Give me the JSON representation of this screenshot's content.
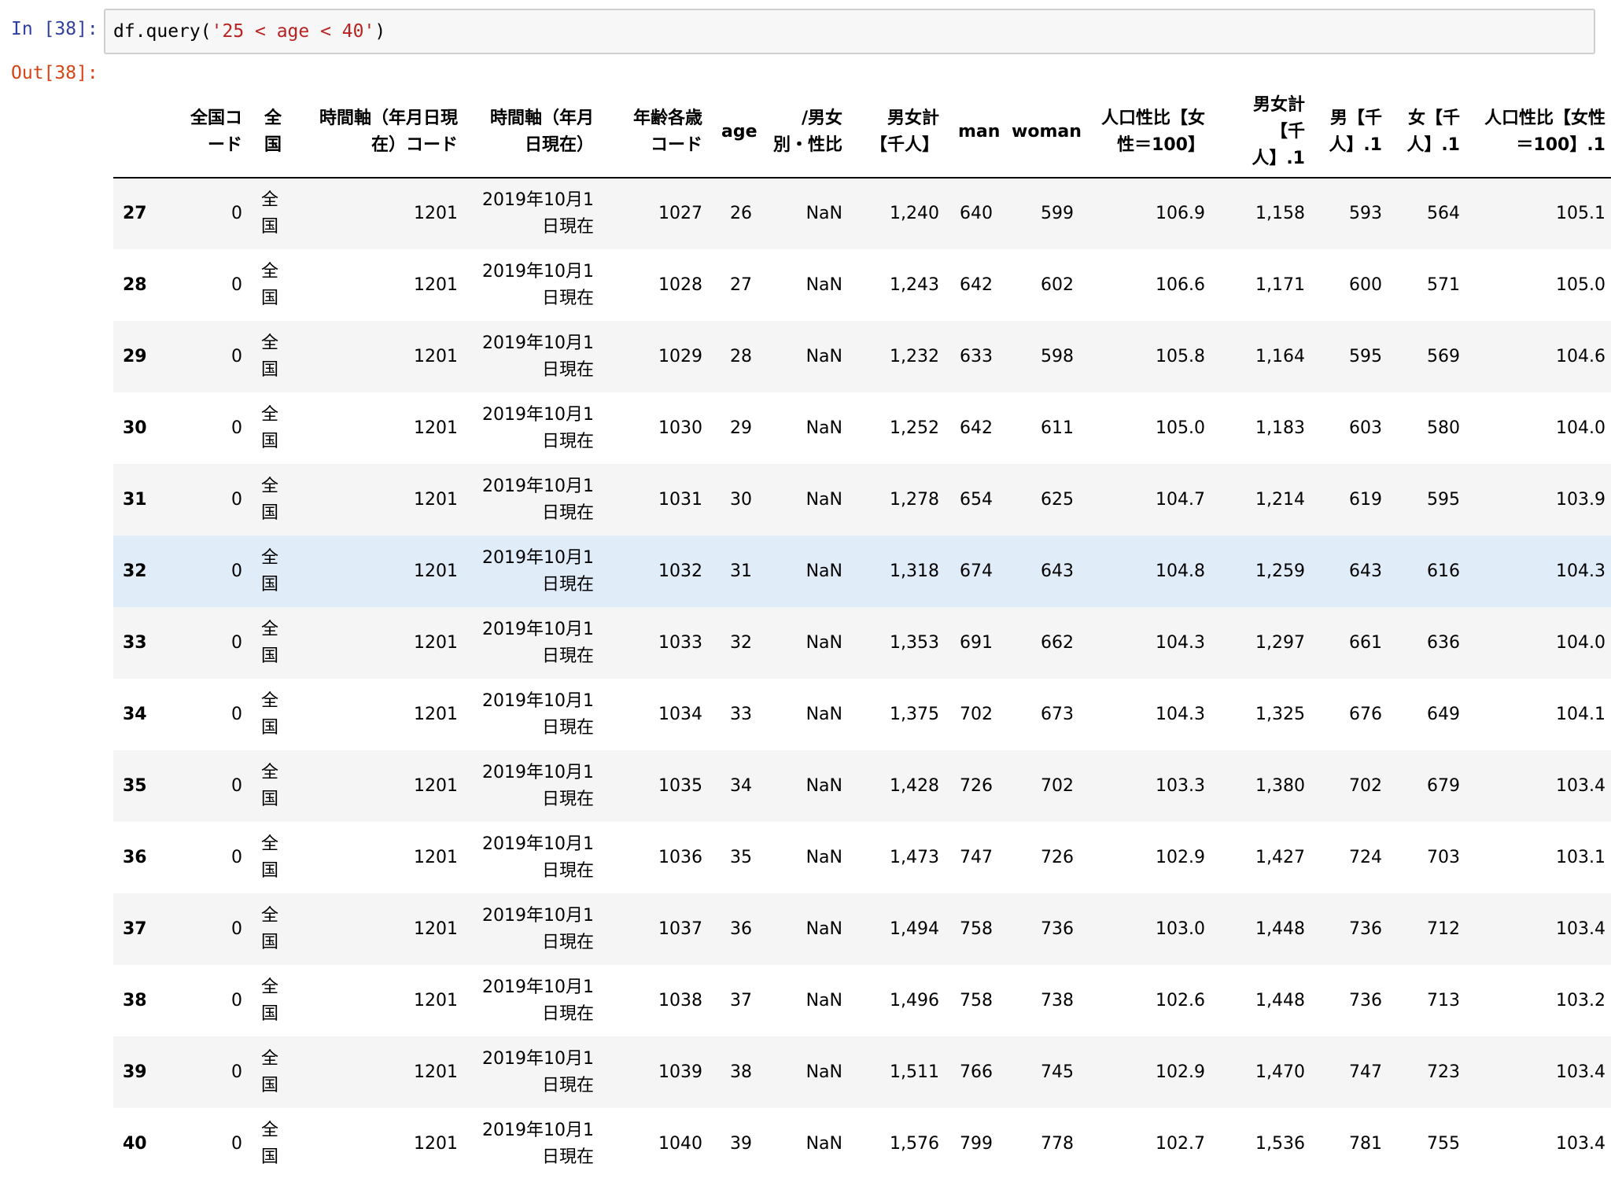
{
  "input_cell": {
    "prompt": "In [38]:",
    "code_prefix": "df.query(",
    "code_string": "'25 < age < 40'",
    "code_suffix": ")"
  },
  "output_cell": {
    "prompt": "Out[38]:"
  },
  "dataframe": {
    "columns": [
      "",
      "全国コード",
      "全国",
      "時間軸（年月日現在）コード",
      "時間軸（年月日現在）",
      "年齢各歳コード",
      "age",
      "/男女別・性比",
      "男女計【千人】",
      "man",
      "woman",
      "人口性比【女性=100】",
      "男女計【千人】.1",
      "男【千人】.1",
      "女【千人】.1",
      "人口性比【女性=100】.1"
    ],
    "column_display": [
      "",
      "全国コ\nード",
      "全\n国",
      "時間軸（年月日現\n在）コード",
      "時間軸（年月\n日現在）",
      "年齢各歳\nコード",
      "age",
      "/男女\n別・性比",
      "男女計\n【千人】",
      "man",
      "woman",
      "人口性比【女\n性＝100】",
      "男女計\n【千\n人】.1",
      "男【千\n人】.1",
      "女【千\n人】.1",
      "人口性比【女性\n＝100】.1"
    ],
    "highlighted_row_index": 32,
    "rows": [
      {
        "index": "27",
        "cells": [
          "0",
          "全\n国",
          "1201",
          "2019年10月1\n日現在",
          "1027",
          "26",
          "NaN",
          "1,240",
          "640",
          "599",
          "106.9",
          "1,158",
          "593",
          "564",
          "105.1"
        ]
      },
      {
        "index": "28",
        "cells": [
          "0",
          "全\n国",
          "1201",
          "2019年10月1\n日現在",
          "1028",
          "27",
          "NaN",
          "1,243",
          "642",
          "602",
          "106.6",
          "1,171",
          "600",
          "571",
          "105.0"
        ]
      },
      {
        "index": "29",
        "cells": [
          "0",
          "全\n国",
          "1201",
          "2019年10月1\n日現在",
          "1029",
          "28",
          "NaN",
          "1,232",
          "633",
          "598",
          "105.8",
          "1,164",
          "595",
          "569",
          "104.6"
        ]
      },
      {
        "index": "30",
        "cells": [
          "0",
          "全\n国",
          "1201",
          "2019年10月1\n日現在",
          "1030",
          "29",
          "NaN",
          "1,252",
          "642",
          "611",
          "105.0",
          "1,183",
          "603",
          "580",
          "104.0"
        ]
      },
      {
        "index": "31",
        "cells": [
          "0",
          "全\n国",
          "1201",
          "2019年10月1\n日現在",
          "1031",
          "30",
          "NaN",
          "1,278",
          "654",
          "625",
          "104.7",
          "1,214",
          "619",
          "595",
          "103.9"
        ]
      },
      {
        "index": "32",
        "cells": [
          "0",
          "全\n国",
          "1201",
          "2019年10月1\n日現在",
          "1032",
          "31",
          "NaN",
          "1,318",
          "674",
          "643",
          "104.8",
          "1,259",
          "643",
          "616",
          "104.3"
        ]
      },
      {
        "index": "33",
        "cells": [
          "0",
          "全\n国",
          "1201",
          "2019年10月1\n日現在",
          "1033",
          "32",
          "NaN",
          "1,353",
          "691",
          "662",
          "104.3",
          "1,297",
          "661",
          "636",
          "104.0"
        ]
      },
      {
        "index": "34",
        "cells": [
          "0",
          "全\n国",
          "1201",
          "2019年10月1\n日現在",
          "1034",
          "33",
          "NaN",
          "1,375",
          "702",
          "673",
          "104.3",
          "1,325",
          "676",
          "649",
          "104.1"
        ]
      },
      {
        "index": "35",
        "cells": [
          "0",
          "全\n国",
          "1201",
          "2019年10月1\n日現在",
          "1035",
          "34",
          "NaN",
          "1,428",
          "726",
          "702",
          "103.3",
          "1,380",
          "702",
          "679",
          "103.4"
        ]
      },
      {
        "index": "36",
        "cells": [
          "0",
          "全\n国",
          "1201",
          "2019年10月1\n日現在",
          "1036",
          "35",
          "NaN",
          "1,473",
          "747",
          "726",
          "102.9",
          "1,427",
          "724",
          "703",
          "103.1"
        ]
      },
      {
        "index": "37",
        "cells": [
          "0",
          "全\n国",
          "1201",
          "2019年10月1\n日現在",
          "1037",
          "36",
          "NaN",
          "1,494",
          "758",
          "736",
          "103.0",
          "1,448",
          "736",
          "712",
          "103.4"
        ]
      },
      {
        "index": "38",
        "cells": [
          "0",
          "全\n国",
          "1201",
          "2019年10月1\n日現在",
          "1038",
          "37",
          "NaN",
          "1,496",
          "758",
          "738",
          "102.6",
          "1,448",
          "736",
          "713",
          "103.2"
        ]
      },
      {
        "index": "39",
        "cells": [
          "0",
          "全\n国",
          "1201",
          "2019年10月1\n日現在",
          "1039",
          "38",
          "NaN",
          "1,511",
          "766",
          "745",
          "102.9",
          "1,470",
          "747",
          "723",
          "103.4"
        ]
      },
      {
        "index": "40",
        "cells": [
          "0",
          "全\n国",
          "1201",
          "2019年10月1\n日現在",
          "1040",
          "39",
          "NaN",
          "1,576",
          "799",
          "778",
          "102.7",
          "1,536",
          "781",
          "755",
          "103.4"
        ]
      }
    ]
  },
  "colors": {
    "in_prompt": "#303f9f",
    "out_prompt": "#d84315",
    "string_literal": "#ba2121",
    "stripe": "#f5f5f5",
    "hover_row": "#e1ecf9"
  }
}
